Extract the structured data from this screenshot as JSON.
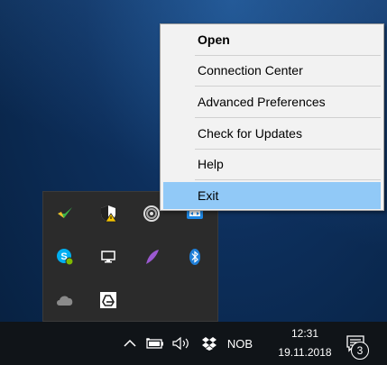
{
  "context_menu": {
    "items": [
      {
        "label": "Open"
      },
      {
        "label": "Connection Center"
      },
      {
        "label": "Advanced Preferences"
      },
      {
        "label": "Check for Updates"
      },
      {
        "label": "Help"
      },
      {
        "label": "Exit"
      }
    ],
    "selected_color": "#91c9f7"
  },
  "tray_flyout": {
    "icons": [
      "bird-icon",
      "shield-warning-icon",
      "spiral-icon",
      "screen-share-icon",
      "skype-icon",
      "monitor-icon",
      "feather-icon",
      "bluetooth-icon",
      "cloud-icon",
      "drive-icon"
    ]
  },
  "taskbar": {
    "language": "NOB",
    "time": "12:31",
    "date": "19.11.2018",
    "notification_count": "3",
    "icons": [
      "chevron-up-icon",
      "battery-icon",
      "volume-icon",
      "dropbox-icon",
      "action-center-icon"
    ]
  }
}
